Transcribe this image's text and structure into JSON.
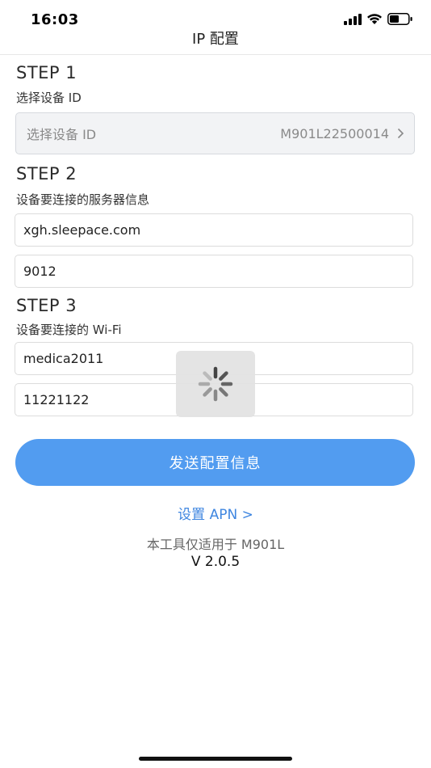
{
  "status_bar": {
    "time": "16:03",
    "icons": [
      "signal-icon",
      "wifi-icon",
      "battery-icon"
    ]
  },
  "nav": {
    "title": "IP 配置"
  },
  "step1": {
    "heading": "STEP 1",
    "description": "选择设备 ID",
    "select_label": "选择设备 ID",
    "select_value": "M901L22500014"
  },
  "step2": {
    "heading": "STEP 2",
    "description": "设备要连接的服务器信息",
    "server_address": "xgh.sleepace.com",
    "server_port": "9012"
  },
  "step3": {
    "heading": "STEP 3",
    "description": "设备要连接的 Wi-Fi",
    "wifi_name": "medica2011",
    "wifi_password": "11221122"
  },
  "actions": {
    "send_label": "发送配置信息",
    "apn_link": "设置 APN >"
  },
  "footer": {
    "note": "本工具仅适用于 M901L",
    "version": "V 2.0.5"
  },
  "colors": {
    "accent": "#529cf0",
    "link": "#3f86e0"
  }
}
